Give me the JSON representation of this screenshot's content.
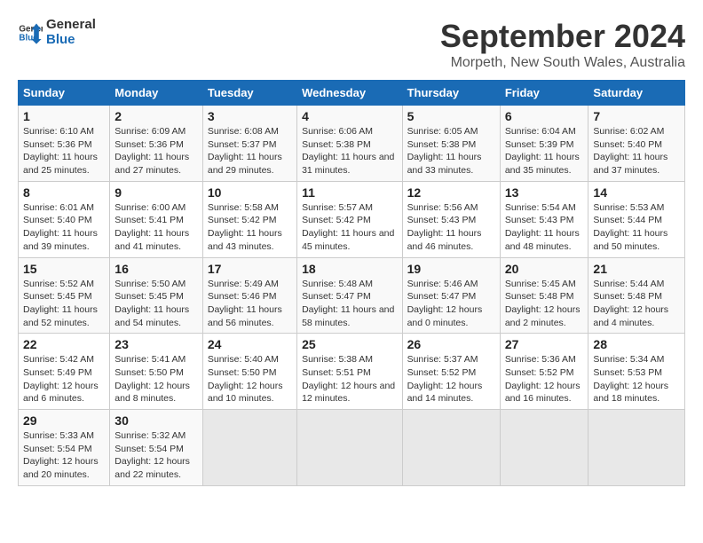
{
  "logo": {
    "line1": "General",
    "line2": "Blue"
  },
  "title": "September 2024",
  "subtitle": "Morpeth, New South Wales, Australia",
  "days_of_week": [
    "Sunday",
    "Monday",
    "Tuesday",
    "Wednesday",
    "Thursday",
    "Friday",
    "Saturday"
  ],
  "weeks": [
    [
      {
        "day": "1",
        "sunrise": "6:10 AM",
        "sunset": "5:36 PM",
        "daylight": "11 hours and 25 minutes."
      },
      {
        "day": "2",
        "sunrise": "6:09 AM",
        "sunset": "5:36 PM",
        "daylight": "11 hours and 27 minutes."
      },
      {
        "day": "3",
        "sunrise": "6:08 AM",
        "sunset": "5:37 PM",
        "daylight": "11 hours and 29 minutes."
      },
      {
        "day": "4",
        "sunrise": "6:06 AM",
        "sunset": "5:38 PM",
        "daylight": "11 hours and 31 minutes."
      },
      {
        "day": "5",
        "sunrise": "6:05 AM",
        "sunset": "5:38 PM",
        "daylight": "11 hours and 33 minutes."
      },
      {
        "day": "6",
        "sunrise": "6:04 AM",
        "sunset": "5:39 PM",
        "daylight": "11 hours and 35 minutes."
      },
      {
        "day": "7",
        "sunrise": "6:02 AM",
        "sunset": "5:40 PM",
        "daylight": "11 hours and 37 minutes."
      }
    ],
    [
      {
        "day": "8",
        "sunrise": "6:01 AM",
        "sunset": "5:40 PM",
        "daylight": "11 hours and 39 minutes."
      },
      {
        "day": "9",
        "sunrise": "6:00 AM",
        "sunset": "5:41 PM",
        "daylight": "11 hours and 41 minutes."
      },
      {
        "day": "10",
        "sunrise": "5:58 AM",
        "sunset": "5:42 PM",
        "daylight": "11 hours and 43 minutes."
      },
      {
        "day": "11",
        "sunrise": "5:57 AM",
        "sunset": "5:42 PM",
        "daylight": "11 hours and 45 minutes."
      },
      {
        "day": "12",
        "sunrise": "5:56 AM",
        "sunset": "5:43 PM",
        "daylight": "11 hours and 46 minutes."
      },
      {
        "day": "13",
        "sunrise": "5:54 AM",
        "sunset": "5:43 PM",
        "daylight": "11 hours and 48 minutes."
      },
      {
        "day": "14",
        "sunrise": "5:53 AM",
        "sunset": "5:44 PM",
        "daylight": "11 hours and 50 minutes."
      }
    ],
    [
      {
        "day": "15",
        "sunrise": "5:52 AM",
        "sunset": "5:45 PM",
        "daylight": "11 hours and 52 minutes."
      },
      {
        "day": "16",
        "sunrise": "5:50 AM",
        "sunset": "5:45 PM",
        "daylight": "11 hours and 54 minutes."
      },
      {
        "day": "17",
        "sunrise": "5:49 AM",
        "sunset": "5:46 PM",
        "daylight": "11 hours and 56 minutes."
      },
      {
        "day": "18",
        "sunrise": "5:48 AM",
        "sunset": "5:47 PM",
        "daylight": "11 hours and 58 minutes."
      },
      {
        "day": "19",
        "sunrise": "5:46 AM",
        "sunset": "5:47 PM",
        "daylight": "12 hours and 0 minutes."
      },
      {
        "day": "20",
        "sunrise": "5:45 AM",
        "sunset": "5:48 PM",
        "daylight": "12 hours and 2 minutes."
      },
      {
        "day": "21",
        "sunrise": "5:44 AM",
        "sunset": "5:48 PM",
        "daylight": "12 hours and 4 minutes."
      }
    ],
    [
      {
        "day": "22",
        "sunrise": "5:42 AM",
        "sunset": "5:49 PM",
        "daylight": "12 hours and 6 minutes."
      },
      {
        "day": "23",
        "sunrise": "5:41 AM",
        "sunset": "5:50 PM",
        "daylight": "12 hours and 8 minutes."
      },
      {
        "day": "24",
        "sunrise": "5:40 AM",
        "sunset": "5:50 PM",
        "daylight": "12 hours and 10 minutes."
      },
      {
        "day": "25",
        "sunrise": "5:38 AM",
        "sunset": "5:51 PM",
        "daylight": "12 hours and 12 minutes."
      },
      {
        "day": "26",
        "sunrise": "5:37 AM",
        "sunset": "5:52 PM",
        "daylight": "12 hours and 14 minutes."
      },
      {
        "day": "27",
        "sunrise": "5:36 AM",
        "sunset": "5:52 PM",
        "daylight": "12 hours and 16 minutes."
      },
      {
        "day": "28",
        "sunrise": "5:34 AM",
        "sunset": "5:53 PM",
        "daylight": "12 hours and 18 minutes."
      }
    ],
    [
      {
        "day": "29",
        "sunrise": "5:33 AM",
        "sunset": "5:54 PM",
        "daylight": "12 hours and 20 minutes."
      },
      {
        "day": "30",
        "sunrise": "5:32 AM",
        "sunset": "5:54 PM",
        "daylight": "12 hours and 22 minutes."
      },
      null,
      null,
      null,
      null,
      null
    ]
  ],
  "labels": {
    "sunrise": "Sunrise:",
    "sunset": "Sunset:",
    "daylight": "Daylight:"
  }
}
